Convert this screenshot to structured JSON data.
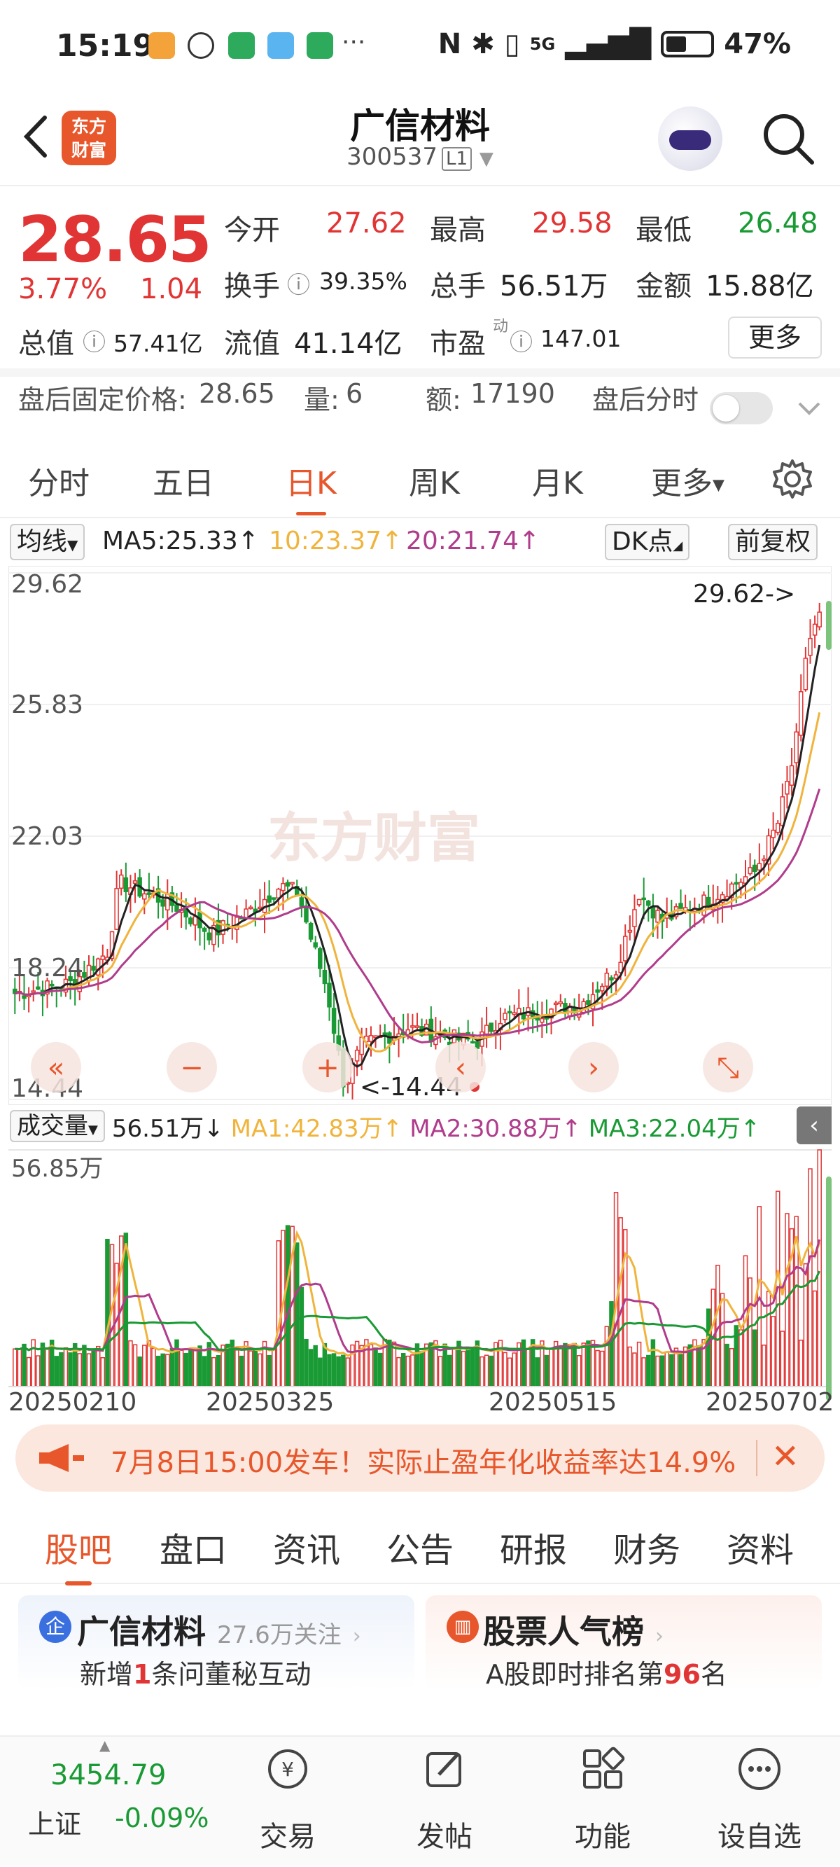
{
  "status_bar": {
    "time": "15:19",
    "more": "···",
    "network": "5G",
    "battery": "47%"
  },
  "header": {
    "logo": "东方财富",
    "stock_name": "广信材料",
    "stock_code": "300537",
    "level": "L1"
  },
  "quote": {
    "price": "28.65",
    "change_pct": "3.77%",
    "change": "1.04",
    "open_label": "今开",
    "open": "27.62",
    "high_label": "最高",
    "high": "29.58",
    "low_label": "最低",
    "low": "26.48",
    "turnover_label": "换手",
    "turnover": "39.35%",
    "volume_label": "总手",
    "volume": "56.51万",
    "amount_label": "金额",
    "amount": "15.88亿",
    "mcap_label": "总值",
    "mcap": "57.41亿",
    "float_label": "流值",
    "float": "41.14亿",
    "pe_label": "市盈",
    "pe_sup": "动",
    "pe": "147.01",
    "more": "更多"
  },
  "after_hours": {
    "price_label": "盘后固定价格:",
    "price": "28.65",
    "vol_label": "量:",
    "vol": "6",
    "amt_label": "额:",
    "amt": "17190",
    "timeshare_label": "盘后分时"
  },
  "chart_tabs": [
    "分时",
    "五日",
    "日K",
    "周K",
    "月K",
    "更多"
  ],
  "ma_bar": {
    "selector": "均线",
    "ma5": "MA5:25.33↑",
    "ma10": "10:23.37↑",
    "ma20": "20:21.74↑",
    "dk": "DK点",
    "adjust": "前复权"
  },
  "kline": {
    "y_ticks": [
      "29.62",
      "25.83",
      "22.03",
      "18.24",
      "14.44"
    ],
    "max_marker": "29.62->",
    "min_marker": "<-14.44",
    "watermark": "东方财富"
  },
  "volume_bar": {
    "selector": "成交量",
    "vol": "56.51万↓",
    "ma1": "MA1:42.83万↑",
    "ma2": "MA2:30.88万↑",
    "ma3": "MA3:22.04万↑",
    "max": "56.85万"
  },
  "dates": [
    "20250210",
    "20250325",
    "20250515",
    "20250702"
  ],
  "ad": {
    "text": "7月8日15:00发车！实际止盈年化收益率达14.9%"
  },
  "sub_tabs": [
    "股吧",
    "盘口",
    "资讯",
    "公告",
    "研报",
    "财务",
    "资料"
  ],
  "cards": {
    "left_title": "广信材料",
    "left_follow": "27.6万关注",
    "left_sub_pre": "新增",
    "left_sub_num": "1",
    "left_sub_post": "条问董秘互动",
    "right_title": "股票人气榜",
    "right_sub_pre": "A股即时排名第",
    "right_sub_num": "96",
    "right_sub_post": "名"
  },
  "index": {
    "value": "3454.79",
    "name": "上证",
    "change": "-0.09%"
  },
  "bottom_nav": [
    "交易",
    "发帖",
    "功能",
    "设自选"
  ],
  "colors": {
    "up": "#e13535",
    "down": "#1a9a35",
    "brand": "#e8562b",
    "ma5": "#222222",
    "ma10": "#f0b43c",
    "ma20": "#b03c8c"
  }
}
